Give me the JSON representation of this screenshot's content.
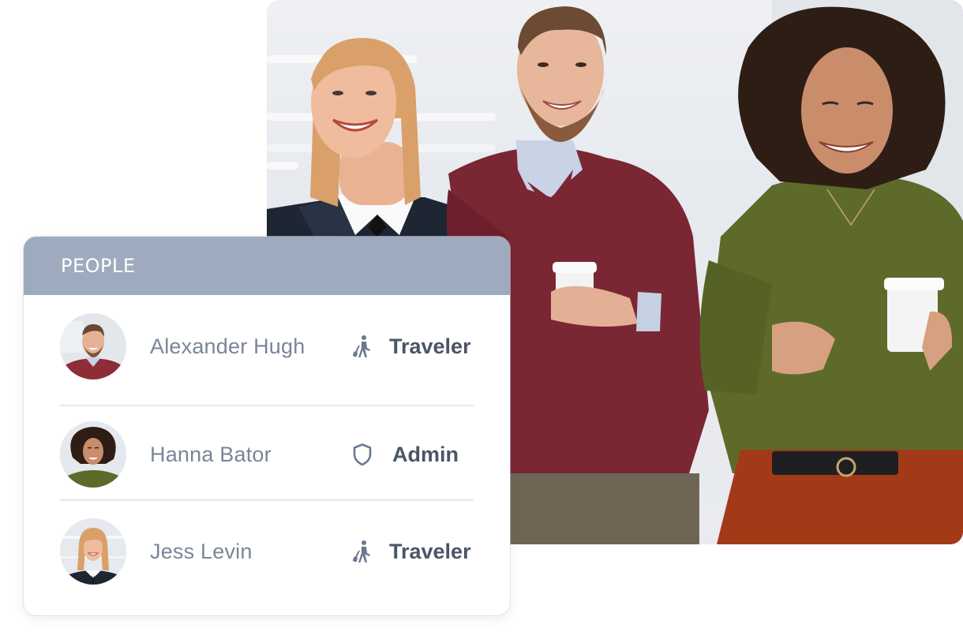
{
  "hero_photo": {
    "description": "Three smiling coworkers walking in an office holding coffee cups"
  },
  "people_card": {
    "title": "PEOPLE",
    "header_color": "#9eaabe",
    "people": [
      {
        "name": "Alexander Hugh",
        "role": "Traveler",
        "role_icon": "traveler-icon",
        "avatar": "man-red-sweater"
      },
      {
        "name": "Hanna Bator",
        "role": "Admin",
        "role_icon": "shield-icon",
        "avatar": "woman-curly-hair"
      },
      {
        "name": "Jess Levin",
        "role": "Traveler",
        "role_icon": "traveler-icon",
        "avatar": "woman-blonde-bob"
      }
    ]
  },
  "colors": {
    "name_text": "#7a8598",
    "role_text": "#4b5566",
    "icon": "#6b7890",
    "divider": "#e4e8f0"
  }
}
